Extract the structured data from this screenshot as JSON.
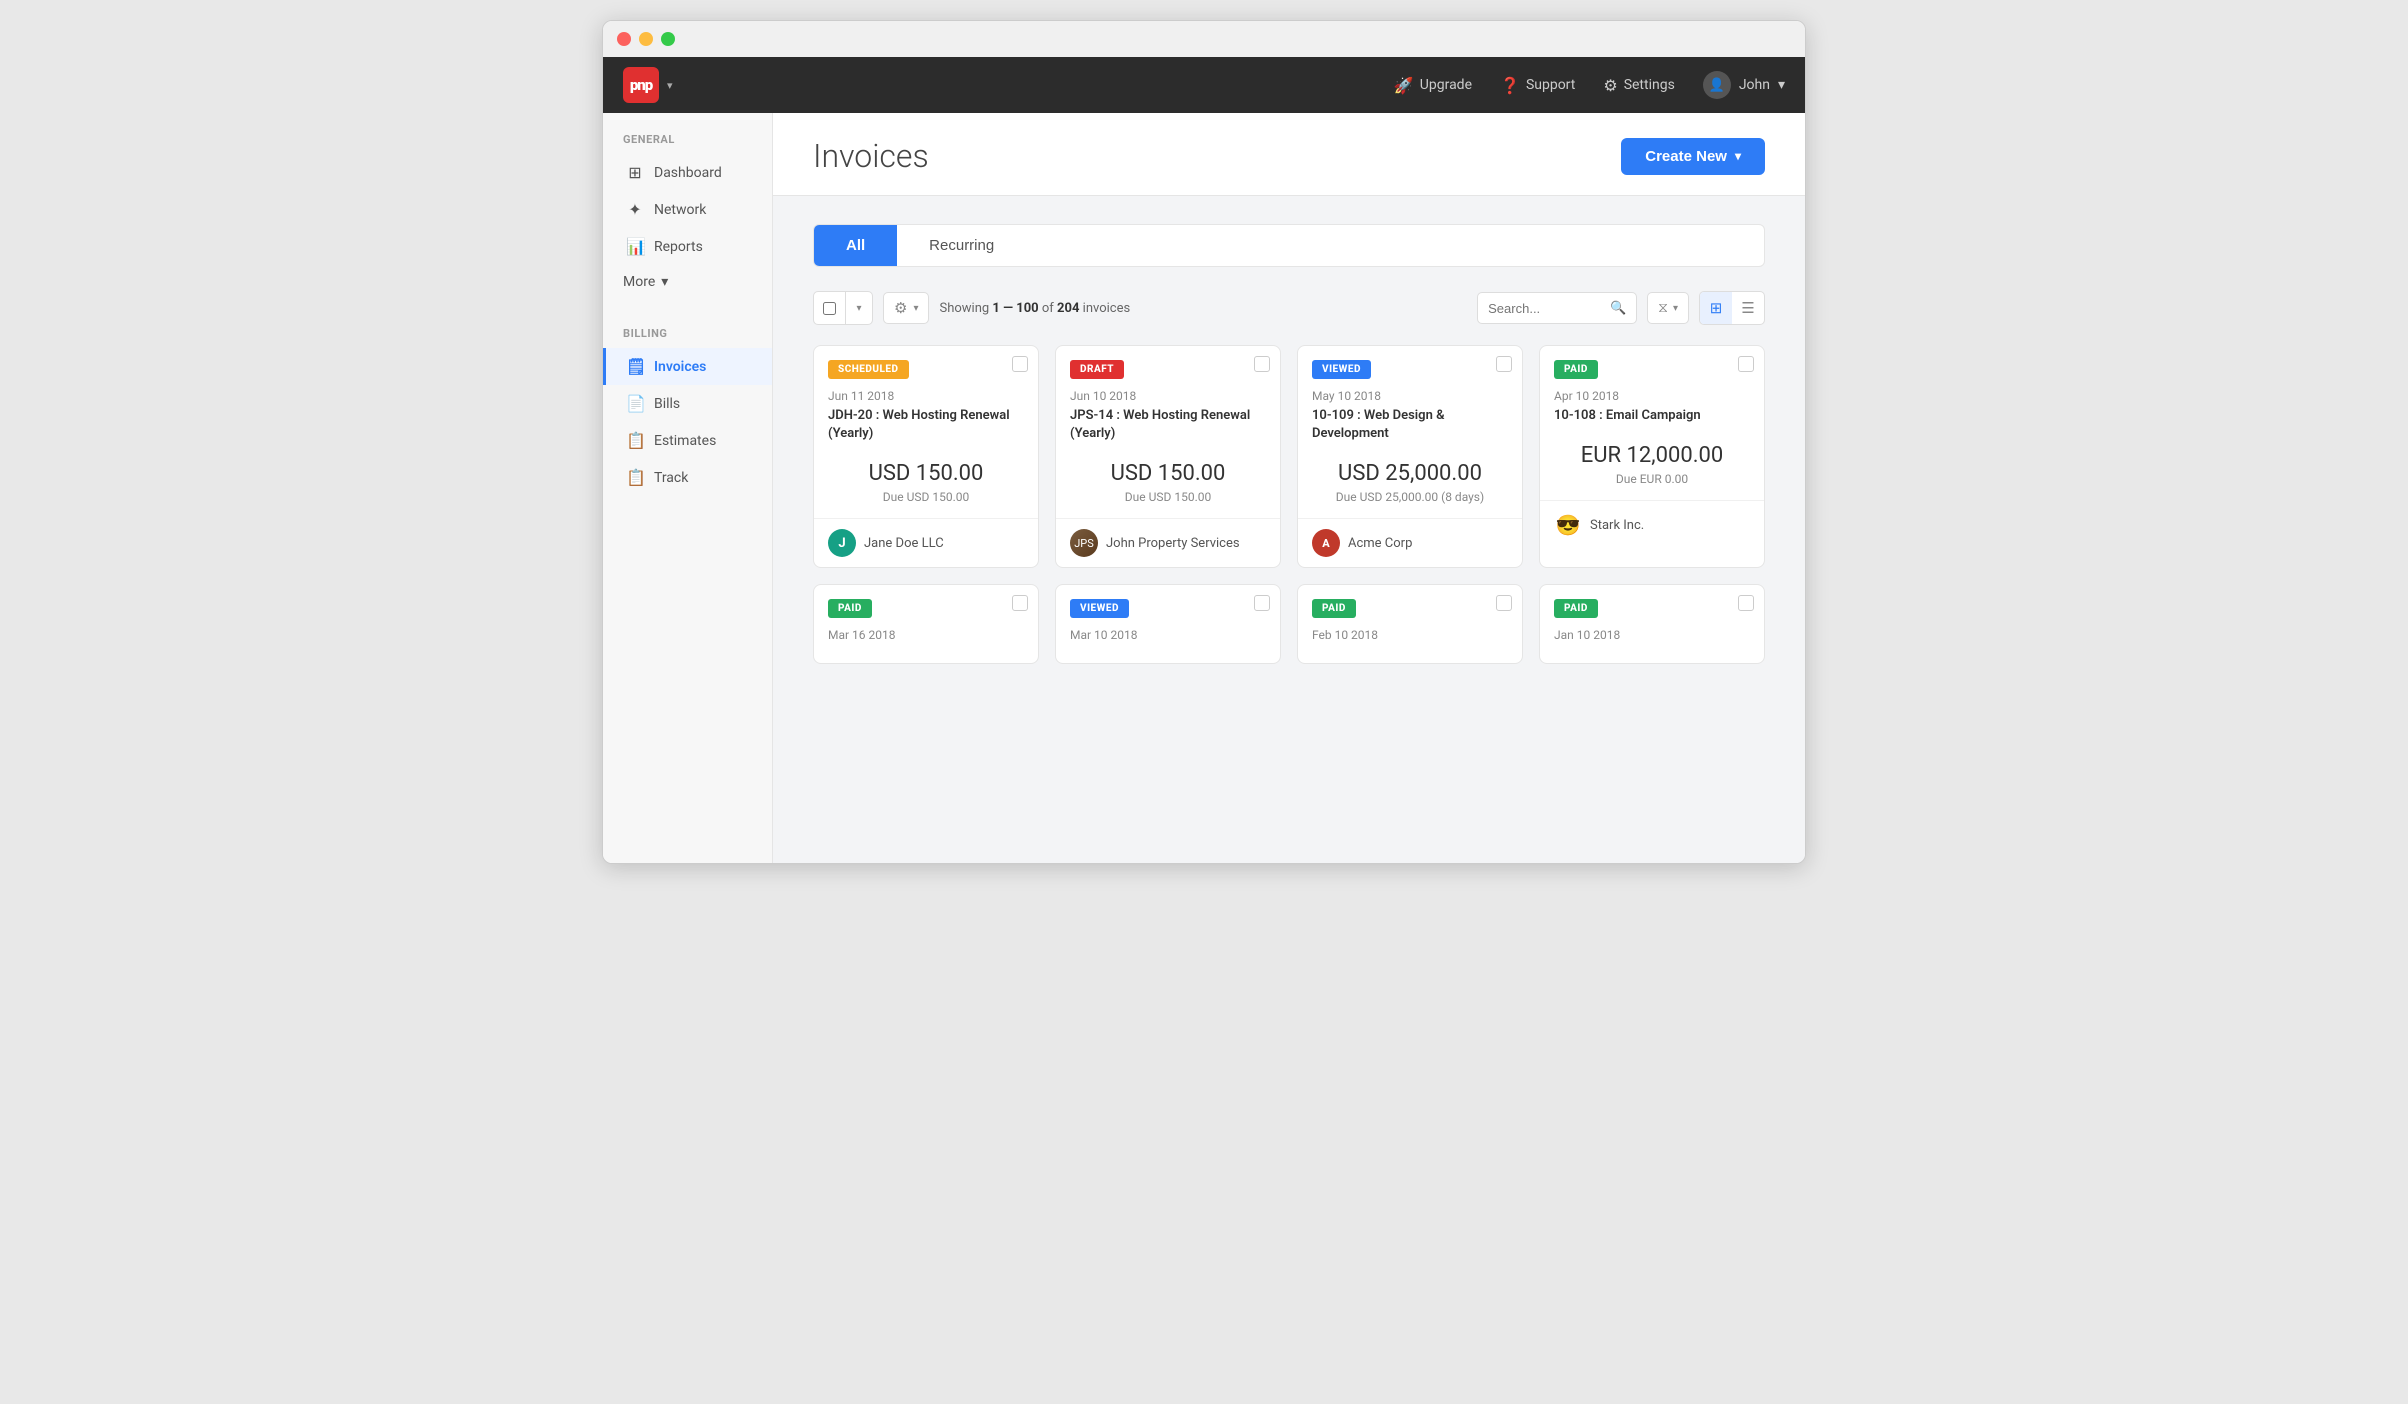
{
  "window": {
    "titlebar_btns": [
      "close",
      "minimize",
      "maximize"
    ]
  },
  "topnav": {
    "logo": "pnp",
    "logo_arrow": "▾",
    "upgrade_label": "Upgrade",
    "support_label": "Support",
    "settings_label": "Settings",
    "user_label": "John",
    "user_arrow": "▾"
  },
  "sidebar": {
    "general_label": "GENERAL",
    "billing_label": "BILLING",
    "items_general": [
      {
        "id": "dashboard",
        "label": "Dashboard",
        "icon": "⊞"
      },
      {
        "id": "network",
        "label": "Network",
        "icon": "✦"
      },
      {
        "id": "reports",
        "label": "Reports",
        "icon": "▐"
      }
    ],
    "more_label": "More",
    "more_arrow": "▾",
    "items_billing": [
      {
        "id": "invoices",
        "label": "Invoices",
        "icon": "🗒",
        "active": true
      },
      {
        "id": "bills",
        "label": "Bills",
        "icon": "📄"
      },
      {
        "id": "estimates",
        "label": "Estimates",
        "icon": "📋"
      },
      {
        "id": "track",
        "label": "Track",
        "icon": "📋"
      }
    ]
  },
  "page": {
    "title": "Invoices",
    "create_btn": "Create New",
    "create_arrow": "▾"
  },
  "tabs": [
    {
      "id": "all",
      "label": "All",
      "active": true
    },
    {
      "id": "recurring",
      "label": "Recurring",
      "active": false
    }
  ],
  "toolbar": {
    "showing_prefix": "Showing",
    "showing_range": "1 — 100",
    "showing_of": "of",
    "showing_count": "204",
    "showing_suffix": "invoices",
    "search_placeholder": "Search..."
  },
  "cards": [
    {
      "badge": "SCHEDULED",
      "badge_type": "scheduled",
      "date": "Jun 11 2018",
      "title": "JDH-20 : Web Hosting Renewal (Yearly)",
      "amount": "USD 150.00",
      "due": "Due USD 150.00",
      "client": "Jane Doe LLC",
      "avatar_letter": "J",
      "avatar_type": "teal"
    },
    {
      "badge": "DRAFT",
      "badge_type": "draft",
      "date": "Jun 10 2018",
      "title": "JPS-14 : Web Hosting Renewal (Yearly)",
      "amount": "USD 150.00",
      "due": "Due USD 150.00",
      "client": "John Property Services",
      "avatar_letter": "photo",
      "avatar_type": "photo"
    },
    {
      "badge": "VIEWED",
      "badge_type": "viewed",
      "date": "May 10 2018",
      "title": "10-109 : Web Design & Development",
      "amount": "USD 25,000.00",
      "due": "Due USD 25,000.00 (8 days)",
      "client": "Acme Corp",
      "avatar_letter": "A",
      "avatar_type": "red"
    },
    {
      "badge": "PAID",
      "badge_type": "paid",
      "date": "Apr 10 2018",
      "title": "10-108 : Email Campaign",
      "amount": "EUR 12,000.00",
      "due": "Due EUR 0.00",
      "client": "Stark Inc.",
      "avatar_letter": "😎",
      "avatar_type": "emoji"
    },
    {
      "badge": "PAID",
      "badge_type": "paid",
      "date": "Mar 16 2018",
      "title": "",
      "amount": "",
      "due": "",
      "client": "",
      "avatar_letter": "",
      "avatar_type": ""
    },
    {
      "badge": "VIEWED",
      "badge_type": "viewed",
      "date": "Mar 10 2018",
      "title": "",
      "amount": "",
      "due": "",
      "client": "",
      "avatar_letter": "",
      "avatar_type": ""
    },
    {
      "badge": "PAID",
      "badge_type": "paid",
      "date": "Feb 10 2018",
      "title": "",
      "amount": "",
      "due": "",
      "client": "",
      "avatar_letter": "",
      "avatar_type": ""
    },
    {
      "badge": "PAID",
      "badge_type": "paid",
      "date": "Jan 10 2018",
      "title": "",
      "amount": "",
      "due": "",
      "client": "",
      "avatar_letter": "",
      "avatar_type": ""
    }
  ]
}
